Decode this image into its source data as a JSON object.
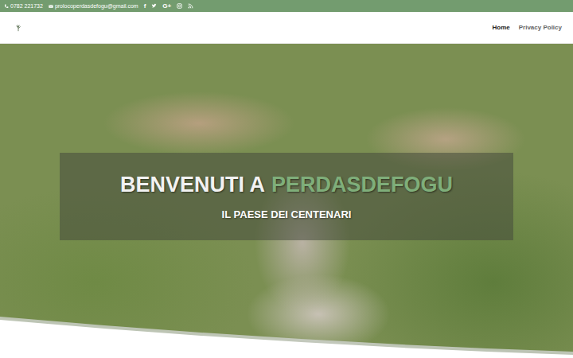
{
  "topbar": {
    "phone": "0782 221732",
    "email": "prolocoperdasdefogu@gmail.com",
    "social": [
      {
        "kind": "text",
        "label": "f"
      },
      {
        "kind": "twitter"
      },
      {
        "kind": "text",
        "label": "G+"
      },
      {
        "kind": "instagram"
      },
      {
        "kind": "rss"
      }
    ]
  },
  "nav": [
    {
      "label": "Home",
      "selected": true
    },
    {
      "label": "Privacy Policy",
      "selected": false
    }
  ],
  "hero": {
    "title": "BENVENUTI A",
    "highlight": "PERDASDEFOGU",
    "subtitle": "IL PAESE DEI CENTENARI"
  }
}
